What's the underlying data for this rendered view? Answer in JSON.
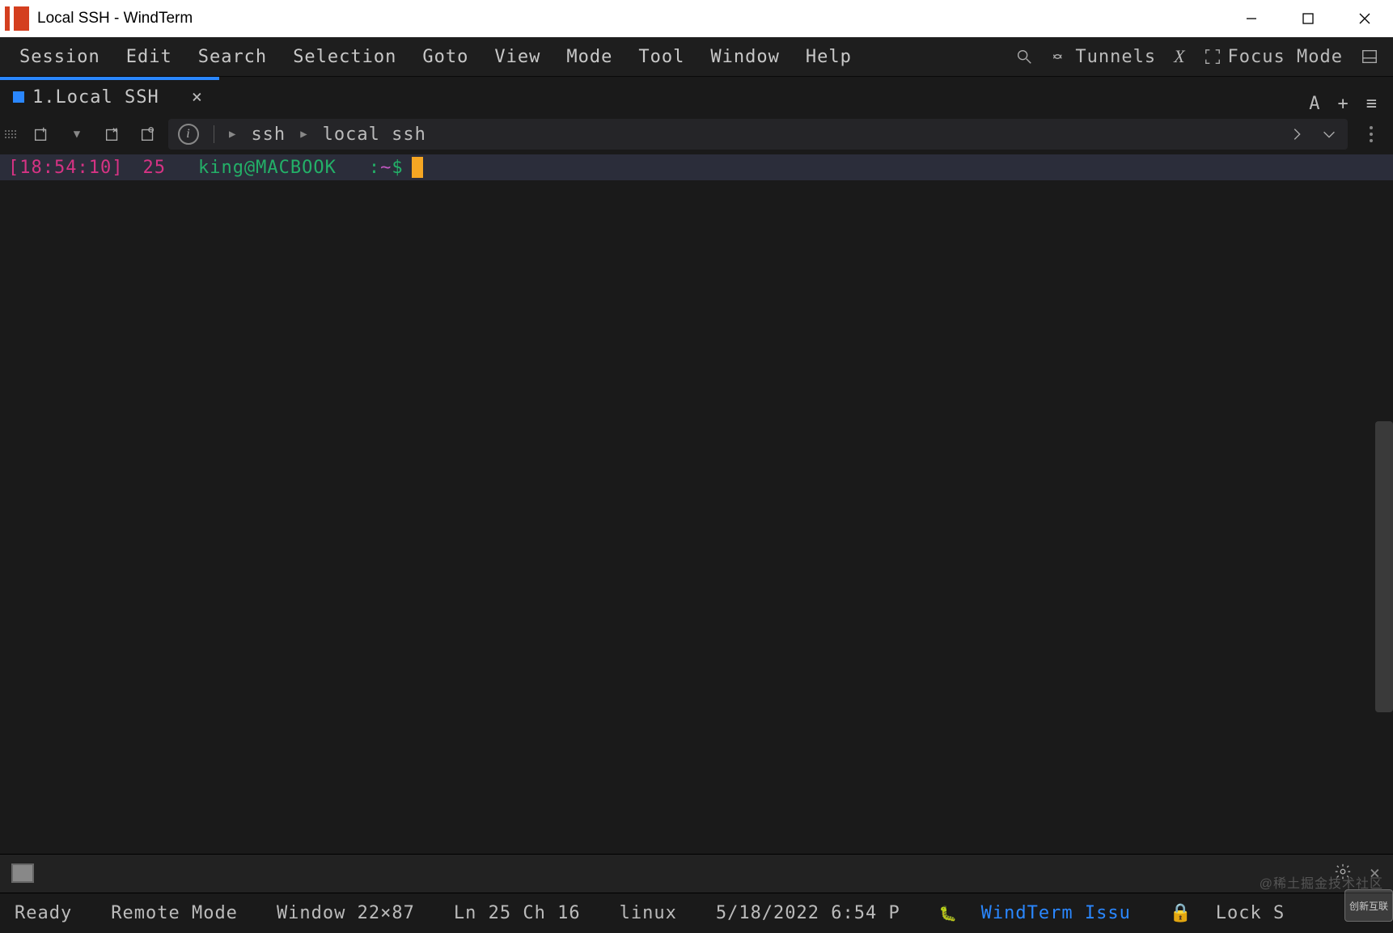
{
  "titlebar": {
    "title": "Local SSH - WindTerm"
  },
  "menu": [
    "Session",
    "Edit",
    "Search",
    "Selection",
    "Goto",
    "View",
    "Mode",
    "Tool",
    "Window",
    "Help"
  ],
  "menuright": {
    "tunnels": "Tunnels",
    "x": "X",
    "focus": "Focus Mode"
  },
  "tab": {
    "label": "1.Local SSH",
    "letter": "A"
  },
  "crumb": {
    "item1": "ssh",
    "item2": "local ssh"
  },
  "prompt": {
    "time": "[18:54:10]",
    "num": "25",
    "user": "king@MACBOOK",
    "sep": ":",
    "path": "~",
    "dollar": "$"
  },
  "status": {
    "ready": "Ready",
    "remote": "Remote Mode",
    "window": "Window 22×87",
    "lnch": "Ln 25 Ch 16",
    "os": "linux",
    "datetime": "5/18/2022 6:54 P",
    "issue": "WindTerm Issu",
    "lock": "Lock S"
  },
  "watermark": {
    "text": "@稀土掘金技术社区",
    "badge": "创新互联"
  }
}
